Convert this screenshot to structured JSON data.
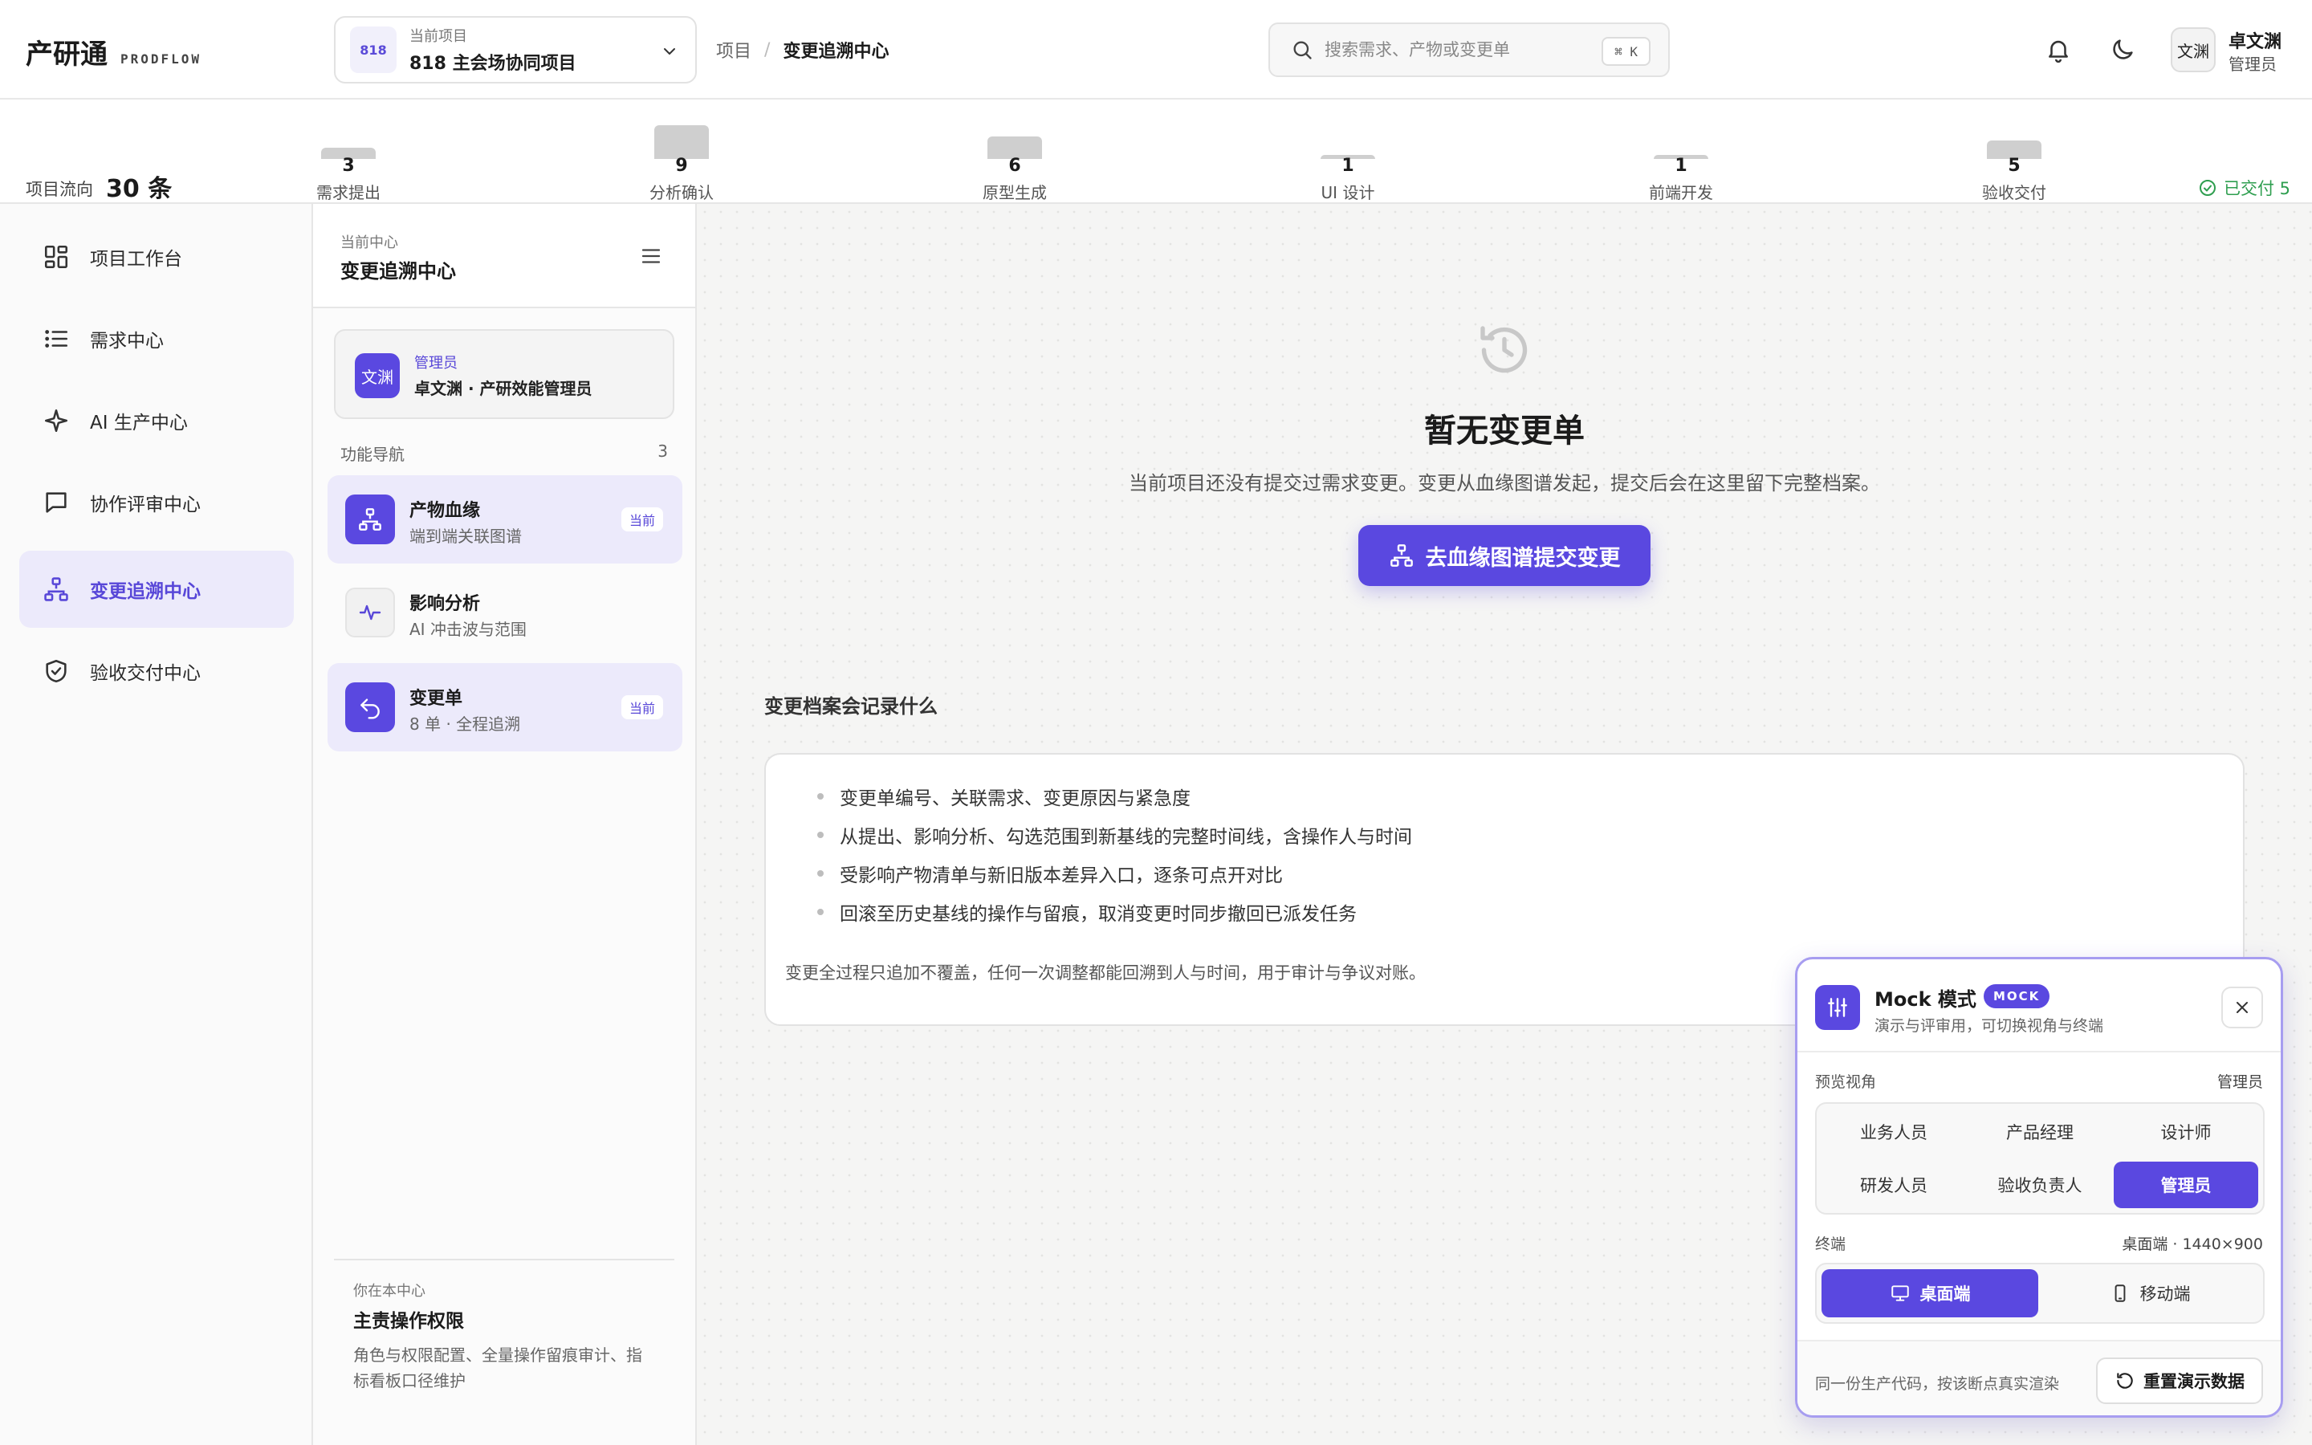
{
  "app": {
    "title": "产研通",
    "subtitle": "PRODFLOW"
  },
  "project": {
    "label": "当前项目",
    "badge": "818",
    "name": "818 主会场协同项目"
  },
  "breadcrumb": {
    "root": "项目",
    "separator": "/",
    "current": "变更追溯中心"
  },
  "search": {
    "placeholder": "搜索需求、产物或变更单",
    "shortcut": "⌘ K"
  },
  "header": {
    "bell_icon": "bell-icon",
    "theme_icon": "moon-icon"
  },
  "user": {
    "avatar": "文渊",
    "name": "卓文渊",
    "role": "管理员"
  },
  "flow": {
    "label": "项目流向",
    "total": "30 条",
    "stages": [
      {
        "count": 3,
        "name": "需求提出"
      },
      {
        "count": 9,
        "name": "分析确认"
      },
      {
        "count": 6,
        "name": "原型生成"
      },
      {
        "count": 1,
        "name": "UI 设计"
      },
      {
        "count": 1,
        "name": "前端开发"
      },
      {
        "count": 5,
        "name": "验收交付"
      }
    ],
    "delivered": "已交付 5",
    "colors": {
      "bar": "#cfcfcf",
      "delivered": "#2e9e4f"
    }
  },
  "nav": {
    "items": [
      {
        "label": "项目工作台",
        "icon": "dashboard-icon"
      },
      {
        "label": "需求中心",
        "icon": "list-icon"
      },
      {
        "label": "AI 生产中心",
        "icon": "sparkle-icon"
      },
      {
        "label": "协作评审中心",
        "icon": "chat-icon"
      },
      {
        "label": "变更追溯中心",
        "icon": "hierarchy-icon",
        "active": true
      },
      {
        "label": "验收交付中心",
        "icon": "shield-check-icon"
      }
    ]
  },
  "subpanel": {
    "kicker": "当前中心",
    "title": "变更追溯中心",
    "admin": {
      "avatar": "文渊",
      "role": "管理员",
      "name": "卓文渊 · 产研效能管理员"
    },
    "func_nav_label": "功能导航",
    "func_nav_count": "3",
    "items": [
      {
        "title": "产物血缘",
        "desc": "端到端关联图谱",
        "tag": "当前",
        "icon": "hierarchy-icon"
      },
      {
        "title": "影响分析",
        "desc": "AI 冲击波与范围",
        "tag": "",
        "icon": "pulse-icon"
      },
      {
        "title": "变更单",
        "desc": "8 单 · 全程追溯",
        "tag": "当前",
        "icon": "undo-icon"
      }
    ],
    "permission": {
      "kicker": "你在本中心",
      "title": "主责操作权限",
      "desc": "角色与权限配置、全量操作留痕审计、指标看板口径维护"
    }
  },
  "main": {
    "empty_icon": "history-icon",
    "empty_title": "暂无变更单",
    "empty_desc": "当前项目还没有提交过需求变更。变更从血缘图谱发起，提交后会在这里留下完整档案。",
    "cta": "去血缘图谱提交变更",
    "section_title": "变更档案会记录什么",
    "records": [
      "变更单编号、关联需求、变更原因与紧急度",
      "从提出、影响分析、勾选范围到新基线的完整时间线，含操作人与时间",
      "受影响产物清单与新旧版本差异入口，逐条可点开对比",
      "回滚至历史基线的操作与留痕，取消变更时同步撤回已派发任务"
    ],
    "note": "变更全过程只追加不覆盖，任何一次调整都能回溯到人与时间，用于审计与争议对账。"
  },
  "mock": {
    "title": "Mock 模式",
    "badge": "MOCK",
    "subtitle": "演示与评审用，可切换视角与终端",
    "view_label": "预览视角",
    "view_value": "管理员",
    "roles": [
      "业务人员",
      "产品经理",
      "设计师",
      "研发人员",
      "验收负责人",
      "管理员"
    ],
    "active_role": "管理员",
    "terminal_label": "终端",
    "terminal_value": "桌面端 · 1440×900",
    "terminals": [
      "桌面端",
      "移动端"
    ],
    "active_terminal": "桌面端",
    "foot_note": "同一份生产代码，按该断点真实渲染",
    "reset": "重置演示数据"
  },
  "colors": {
    "accent": "#5a48e0",
    "accent_soft": "#eceafb"
  }
}
